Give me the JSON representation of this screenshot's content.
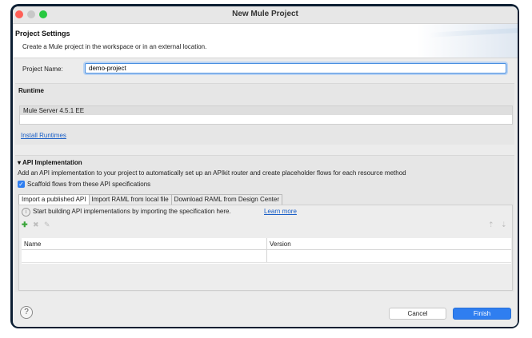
{
  "window": {
    "title": "New Mule Project"
  },
  "header": {
    "title": "Project Settings",
    "description": "Create a Mule project in the workspace or in an external location."
  },
  "project": {
    "name_label": "Project Name:",
    "name_value": "demo-project"
  },
  "runtime": {
    "title": "Runtime",
    "selected": "Mule Server 4.5.1 EE",
    "install_link": "Install Runtimes"
  },
  "api": {
    "title": "API Implementation",
    "description": "Add an API implementation to your project to automatically set up an APIkit router and create placeholder flows for each resource method",
    "scaffold_label": "Scaffold flows from these API specifications",
    "scaffold_checked": true,
    "tabs": [
      {
        "label": "Import a published API"
      },
      {
        "label": "Import RAML from local file"
      },
      {
        "label": "Download RAML from Design Center"
      }
    ],
    "info_text": "Start building API implementations by importing the specification here.",
    "learn_more": "Learn more",
    "columns": [
      "Name",
      "Version"
    ]
  },
  "footer": {
    "cancel_label": "Cancel",
    "finish_label": "Finish",
    "help_glyph": "?"
  },
  "icons": {
    "info": "info-icon",
    "add": "add-icon",
    "remove": "remove-icon",
    "edit": "edit-icon",
    "move_up": "move-up-icon",
    "move_down": "move-down-icon",
    "help": "help-icon"
  },
  "colors": {
    "accent": "#2f7ef0",
    "link": "#1a5fc7",
    "close": "#ff5f57",
    "zoom": "#28c840"
  }
}
